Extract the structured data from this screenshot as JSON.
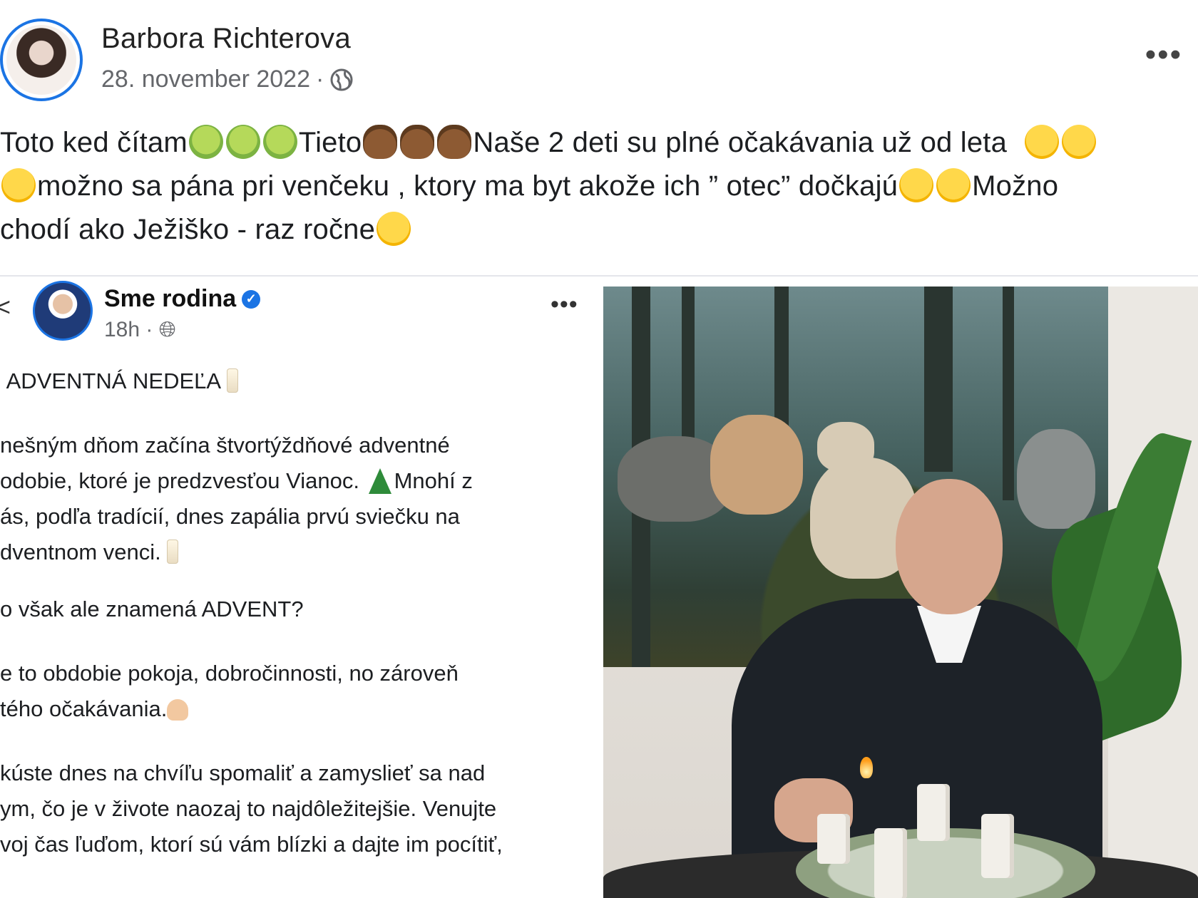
{
  "post": {
    "author": "Barbora Richterova",
    "date": "28. november 2022",
    "separator": "·",
    "more_label": "•••",
    "text": {
      "line1_a": "Toto ked čítam",
      "line1_b": "Tieto",
      "line1_c": "Naše 2 deti su plné očakávania už od leta",
      "line2_a": "možno sa pána pri venčeku , ktory ma byt akože ich ” otec” dočkajú",
      "line2_b": "Možno",
      "line3_a": "chodí ako Ježiško - raz ročne"
    },
    "emojis": {
      "sick": "nauseated-face-icon",
      "poo": "pile-of-poo-icon",
      "smile": "grinning-face-icon"
    }
  },
  "embed": {
    "page_name": "Sme rodina",
    "time": "18h",
    "separator": "·",
    "more_label": "•••",
    "back_label": "<",
    "lines": {
      "heading": "ADVENTNÁ NEDEĽA",
      "p1_l1": "nešným dňom začína štvortýždňové adventné",
      "p1_l2_a": "odobie, ktoré je predzvesťou Vianoc.",
      "p1_l2_b": "Mnohí z",
      "p1_l3": "ás, podľa tradícií, dnes zapália prvú sviečku na",
      "p1_l4": "dventnom venci.",
      "p2": "o však ale znamená ADVENT?",
      "p3_l1": "e to obdobie pokoja, dobročinnosti, no zároveň",
      "p3_l2": "tého očakávania.",
      "p4_l1": "kúste dnes na chvíľu spomaliť a zamyslieť sa nad",
      "p4_l2": "ym, čo je v živote naozaj to najdôležitejšie. Venujte",
      "p4_l3": "voj čas ľuďom, ktorí sú vám blízki a dajte im pocítiť,"
    }
  },
  "colors": {
    "accent": "#1b74e4",
    "meta_text": "#65676b",
    "text": "#1c1e21"
  }
}
